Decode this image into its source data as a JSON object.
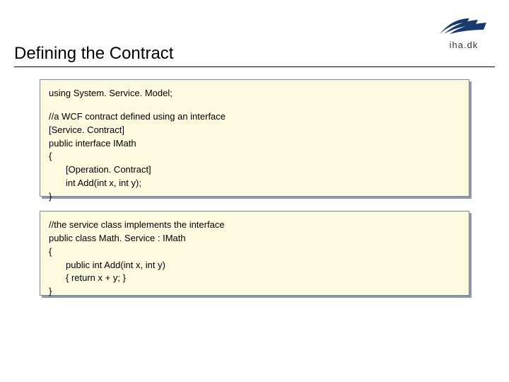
{
  "logo": {
    "text": "iha.dk"
  },
  "title": "Defining the Contract",
  "box1": {
    "l1": "using System. Service. Model;",
    "l2": "//a WCF contract defined using an interface",
    "l3": "[Service. Contract]",
    "l4": "public interface IMath",
    "l5": "{",
    "l6": "[Operation. Contract]",
    "l7": "int Add(int x, int y);",
    "l8": "}"
  },
  "box2": {
    "l1": "//the service class implements the interface",
    "l2": "public class Math. Service : IMath",
    "l3": "{",
    "l4": "public int Add(int x, int y)",
    "l5": "{ return x + y; }",
    "l6": "}"
  }
}
